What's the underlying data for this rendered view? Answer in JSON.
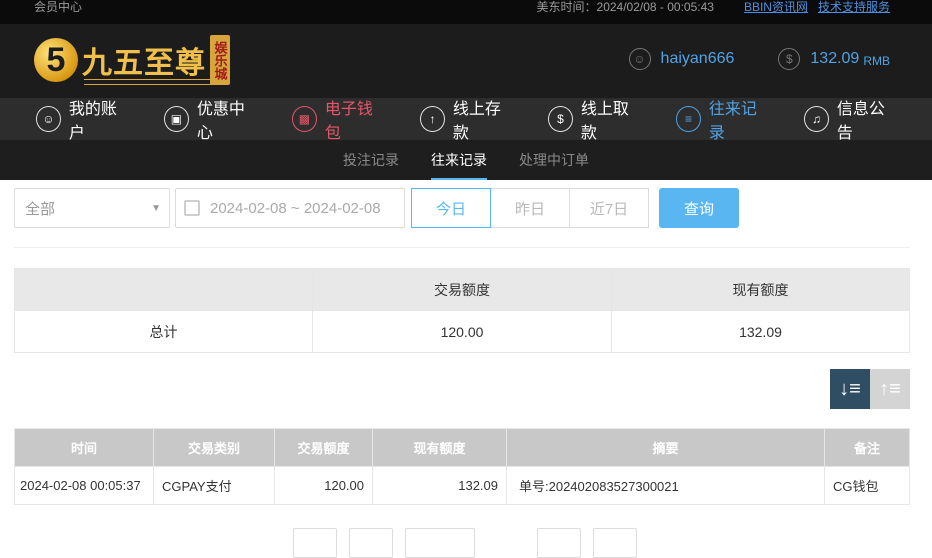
{
  "topbar": {
    "member_center": "会员中心",
    "time_label": "美东时间：2024/02/08 - 00:05:43",
    "link_bbin": "BBIN资讯网",
    "link_support": "技术支持服务"
  },
  "brand": {
    "logo_number": "5",
    "name": "九五至尊",
    "seal": "娱乐城"
  },
  "user": {
    "username": "haiyan666",
    "balance": "132.09",
    "currency": "RMB"
  },
  "nav": {
    "items": [
      {
        "label": "我的账户",
        "icon": "user-icon"
      },
      {
        "label": "优惠中心",
        "icon": "gift-icon"
      },
      {
        "label": "电子钱包",
        "icon": "wallet-icon"
      },
      {
        "label": "线上存款",
        "icon": "deposit-icon"
      },
      {
        "label": "线上取款",
        "icon": "withdraw-icon"
      },
      {
        "label": "往来记录",
        "icon": "records-icon"
      },
      {
        "label": "信息公告",
        "icon": "bell-icon"
      }
    ]
  },
  "subnav": {
    "tabs": [
      "投注记录",
      "往来记录",
      "处理中订单"
    ]
  },
  "filters": {
    "type_select": "全部",
    "date_range": "2024-02-08 ~ 2024-02-08",
    "quick": [
      "今日",
      "昨日",
      "近7日"
    ],
    "query_button": "查询"
  },
  "summary": {
    "headers": [
      "",
      "交易额度",
      "现有额度"
    ],
    "row": [
      "总计",
      "120.00",
      "132.09"
    ]
  },
  "records": {
    "headers": [
      "时间",
      "交易类别",
      "交易额度",
      "现有额度",
      "摘要",
      "备注"
    ],
    "rows": [
      [
        "2024-02-08 00:05:37",
        "CGPAY支付",
        "120.00",
        "132.09",
        "单号:202402083527300021",
        "CG钱包"
      ]
    ]
  },
  "colors": {
    "accent": "#5ab6f0",
    "active_nav": "#4fa3e6",
    "wallet_red": "#e5566a",
    "gold": "#f0c04a"
  }
}
